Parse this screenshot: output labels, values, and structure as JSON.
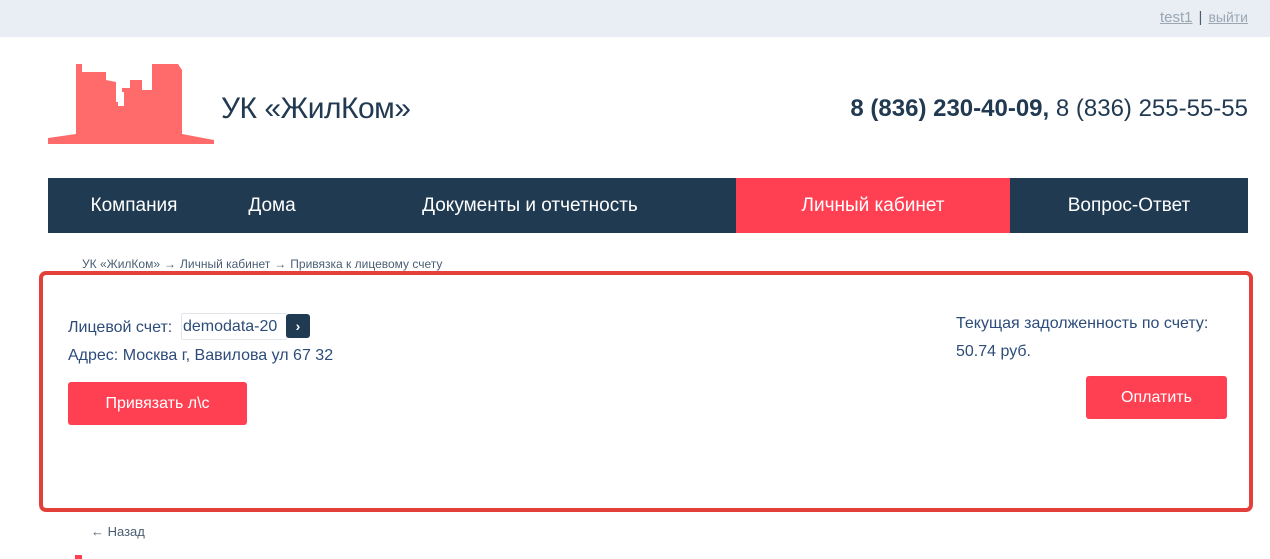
{
  "top_bar": {
    "username": "test1",
    "separator": "|",
    "logout": "выйти"
  },
  "header": {
    "brand": "УК «ЖилКом»",
    "phone_main": "8 (836) 230-40-09,",
    "phone_secondary": "8 (836) 255-55-55",
    "logo_icon": "buildings-logo-icon",
    "logo_color": "#ff6b6b"
  },
  "nav": {
    "items": [
      "Компания",
      "Дома",
      "Документы и отчетность",
      "Личный кабинет",
      "Вопрос-Ответ"
    ],
    "active_index": 3,
    "bg_color": "#203a52",
    "active_color": "#ff4052"
  },
  "breadcrumb": {
    "items": [
      "УК «ЖилКом»",
      "Личный кабинет",
      "Привязка к лицевому счету"
    ],
    "separator": "→"
  },
  "account": {
    "label": "Лицевой счет:",
    "value": "demodata-20",
    "go_icon": "chevron-right-icon",
    "go_symbol": "›",
    "address": "Адрес: Москва г, Вавилова ул 67 32",
    "bind_button": "Привязать л\\с"
  },
  "debt": {
    "label": "Текущая задолженность по счету:",
    "amount": "50.74 руб.",
    "pay_button": "Оплатить"
  },
  "back_link": "← Назад",
  "accent_color": "#ff4052",
  "highlight_color": "#e3403b"
}
